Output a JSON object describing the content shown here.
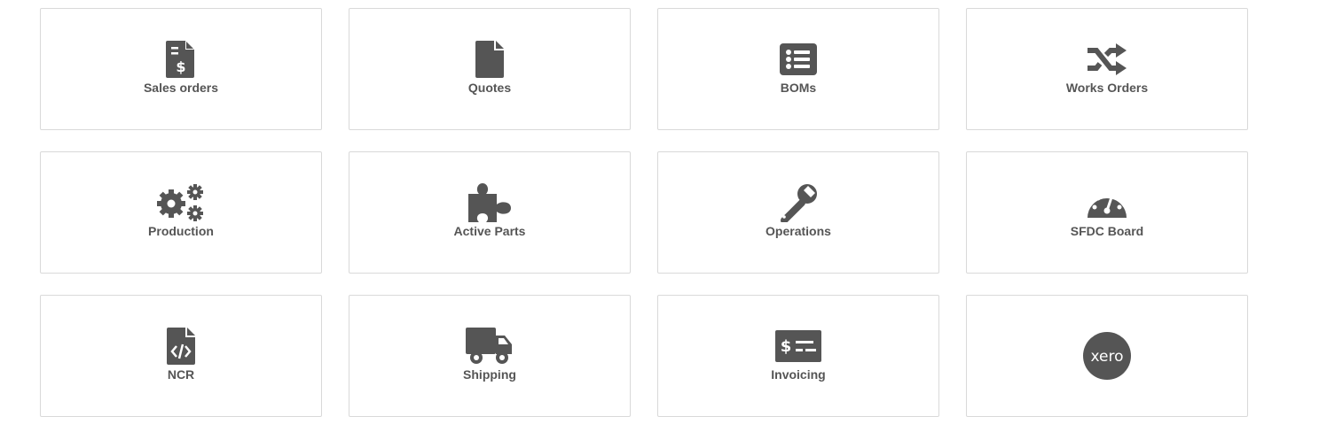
{
  "tiles": [
    {
      "label": "Sales orders",
      "icon": "file-invoice-dollar-icon"
    },
    {
      "label": "Quotes",
      "icon": "file-icon"
    },
    {
      "label": "BOMs",
      "icon": "list-alt-icon"
    },
    {
      "label": "Works Orders",
      "icon": "random-icon"
    },
    {
      "label": "Production",
      "icon": "cogs-icon"
    },
    {
      "label": "Active Parts",
      "icon": "puzzle-piece-icon"
    },
    {
      "label": "Operations",
      "icon": "wrench-icon"
    },
    {
      "label": "SFDC Board",
      "icon": "tachometer-icon"
    },
    {
      "label": "NCR",
      "icon": "file-code-icon"
    },
    {
      "label": "Shipping",
      "icon": "truck-icon"
    },
    {
      "label": "Invoicing",
      "icon": "money-check-icon"
    },
    {
      "label": "",
      "icon": "xero-logo-icon",
      "logo_text": "xero"
    }
  ],
  "colors": {
    "icon": "#555555",
    "label": "#555555",
    "border": "#d9d9d9",
    "background": "#ffffff"
  }
}
